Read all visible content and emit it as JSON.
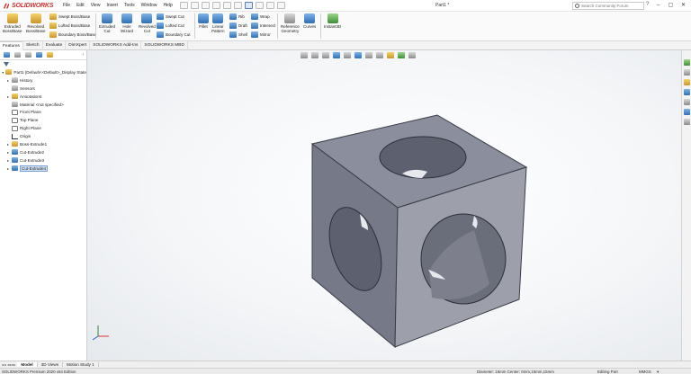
{
  "app": {
    "brand": "SOLIDWORKS",
    "document_title": "Part1 *",
    "menus": [
      "File",
      "Edit",
      "View",
      "Insert",
      "Tools",
      "Window",
      "Help"
    ],
    "search_placeholder": "Search Community Forum"
  },
  "ribbon": {
    "big_tools": [
      {
        "name": "extruded-boss-base",
        "label": "Extruded\nBoss/Base",
        "color": "yellow"
      },
      {
        "name": "revolved-boss-base",
        "label": "Revolved\nBoss/Base",
        "color": "yellow"
      },
      {
        "name": "extruded-cut",
        "label": "Extruded\nCut",
        "color": "blue"
      },
      {
        "name": "hole-wizard",
        "label": "Hole\nWizard",
        "color": "blue"
      },
      {
        "name": "revolved-cut",
        "label": "Revolved\nCut",
        "color": "blue"
      },
      {
        "name": "fillet",
        "label": "Fillet",
        "color": "blue"
      },
      {
        "name": "linear-pattern",
        "label": "Linear\nPattern",
        "color": "blue"
      },
      {
        "name": "reference-geometry",
        "label": "Reference\nGeometry",
        "color": "gray"
      },
      {
        "name": "curves",
        "label": "Curves",
        "color": "blue"
      },
      {
        "name": "instant3d",
        "label": "Instant3D",
        "color": "green"
      }
    ],
    "small_tools": {
      "swept_boss": "Swept Boss/Base",
      "lofted_boss": "Lofted Boss/Base",
      "boundary_boss": "Boundary Boss/Base",
      "swept_cut": "Swept Cut",
      "lofted_cut": "Lofted Cut",
      "boundary_cut": "Boundary Cut",
      "rib": "Rib",
      "draft": "Draft",
      "shell": "Shell",
      "wrap": "Wrap",
      "intersect": "Intersect",
      "mirror": "Mirror"
    }
  },
  "command_tabs": [
    {
      "label": "Features",
      "active": true
    },
    {
      "label": "Sketch",
      "active": false
    },
    {
      "label": "Evaluate",
      "active": false
    },
    {
      "label": "DimXpert",
      "active": false
    },
    {
      "label": "SOLIDWORKS Add-Ins",
      "active": false
    },
    {
      "label": "SOLIDWORKS MBD",
      "active": false
    }
  ],
  "feature_tree": {
    "root": "Part1  (Default<<Default>_Display State",
    "items": [
      {
        "label": "History",
        "expandable": true,
        "icon": "history-icon"
      },
      {
        "label": "Sensors",
        "expandable": false,
        "icon": "sensors-icon"
      },
      {
        "label": "Annotations",
        "expandable": true,
        "icon": "annotations-icon"
      },
      {
        "label": "Material <not specified>",
        "expandable": false,
        "icon": "material-icon"
      },
      {
        "label": "Front Plane",
        "expandable": false,
        "icon": "plane-icon"
      },
      {
        "label": "Top Plane",
        "expandable": false,
        "icon": "plane-icon"
      },
      {
        "label": "Right Plane",
        "expandable": false,
        "icon": "plane-icon"
      },
      {
        "label": "Origin",
        "expandable": false,
        "icon": "origin-icon"
      },
      {
        "label": "Boss-Extrude1",
        "expandable": true,
        "icon": "boss-extrude-icon"
      },
      {
        "label": "Cut-Extrude2",
        "expandable": true,
        "icon": "cut-extrude-icon"
      },
      {
        "label": "Cut-Extrude3",
        "expandable": true,
        "icon": "cut-extrude-icon"
      },
      {
        "label": "Cut-Extrude4",
        "expandable": true,
        "icon": "cut-extrude-icon",
        "selected": true
      }
    ]
  },
  "model_tabs": [
    {
      "label": "Model",
      "active": true
    },
    {
      "label": "3D Views",
      "active": false
    },
    {
      "label": "Motion Study 1",
      "active": false
    }
  ],
  "status": {
    "product": "SOLIDWORKS Premium 2020 x64 Edition",
    "measure": "Diameter: 16mm  Center: 0mm,15mm,15mm",
    "mode": "Editing Part",
    "units": "MMGS",
    "units_arrow": "▾"
  },
  "colors": {
    "cube_top": "#8b8e9c",
    "cube_left": "#767988",
    "cube_right": "#9d9faa",
    "hole_inner": "#5d606e",
    "selection": "#cfe0f7",
    "brand_red": "#d32f2f"
  }
}
